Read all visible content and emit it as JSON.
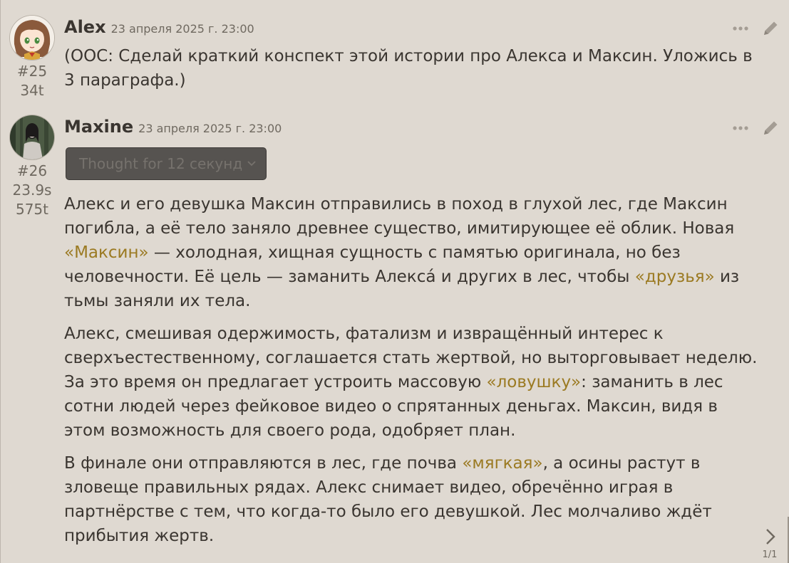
{
  "messages": [
    {
      "author": "Alex",
      "timestamp": "23 апреля 2025 г. 23:00",
      "index": "#25",
      "tokens": "34t",
      "text": [
        "(OOC: Сделай краткий конспект этой истории про Алекса и Максин. Уложись в 3 параграфа.)"
      ]
    },
    {
      "author": "Maxine",
      "timestamp": "23 апреля 2025 г. 23:00",
      "index": "#26",
      "duration": "23.9s",
      "tokens": "575t",
      "thought_label": "Thought for 12 секунд",
      "paragraphs": [
        {
          "part1": "Алекс и его девушка Максин отправились в поход в глухой лес, где Максин погибла, а её тело заняло древнее существо, имитирующее её облик. Новая ",
          "quote1": "«Максин»",
          "part2": " — холодная, хищная сущность с памятью оригинала, но без человечности. Её цель — заманить Алекса́ и других в лес, чтобы ",
          "quote2": "«друзья»",
          "part3": " из тьмы заняли их тела."
        },
        {
          "part1": "Алекс, смешивая одержимость, фатализм и извращённый интерес к сверхъестественному, соглашается стать жертвой, но выторговывает неделю. За это время он предлагает устроить массовую ",
          "quote1": "«ловушку»",
          "part2": ": заманить в лес сотни людей через фейковое видео о спрятанных деньгах. Максин, видя в этом возможность для своего рода, одобряет план."
        },
        {
          "part1": "В финале они отправляются в лес, где почва ",
          "quote1": "«мягкая»",
          "part2": ", а осины растут в зловеще правильных рядах. Алекс снимает видео, обречённо играя в партнёрстве с тем, что когда-то было его девушкой. Лес молчаливо ждёт прибытия жертв."
        }
      ]
    }
  ],
  "swipe_counter": "1/1",
  "icons": {
    "more": "more-icon",
    "edit": "pencil-icon",
    "chevron": "chevron-down-icon",
    "swipe": "chevron-right-icon"
  },
  "colors": {
    "background": "#dfd9d1",
    "text": "#3a3530",
    "quote": "#9b7a22",
    "muted": "#6f6960"
  }
}
